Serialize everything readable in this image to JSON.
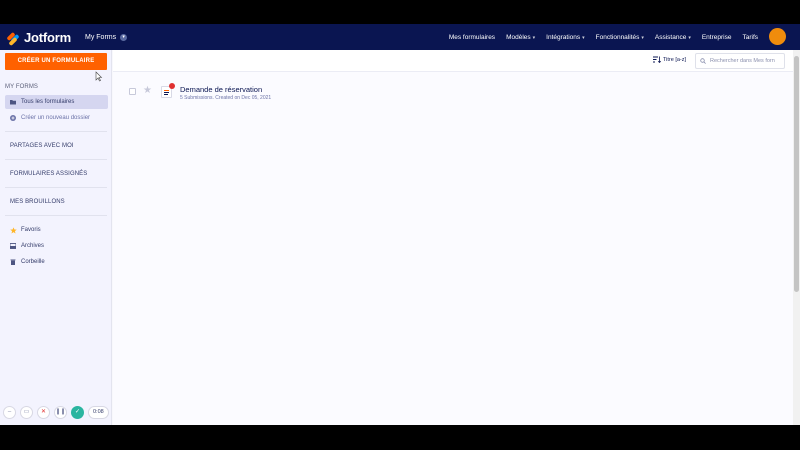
{
  "brand": {
    "name": "Jotform"
  },
  "header": {
    "context_label": "My Forms",
    "nav": [
      {
        "label": "Mes formulaires",
        "has_caret": false
      },
      {
        "label": "Modèles",
        "has_caret": true
      },
      {
        "label": "Intégrations",
        "has_caret": true
      },
      {
        "label": "Fonctionnalités",
        "has_caret": true
      },
      {
        "label": "Assistance",
        "has_caret": true
      },
      {
        "label": "Entreprise",
        "has_caret": false
      },
      {
        "label": "Tarifs",
        "has_caret": false
      }
    ]
  },
  "sidebar": {
    "create_label": "CRÉER UN FORMULAIRE",
    "my_forms_title": "MY FORMS",
    "all_forms_label": "Tous les formulaires",
    "new_folder_label": "Créer un nouveau dossier",
    "shared_label": "PARTAGES AVEC MOI",
    "assigned_label": "FORMULAIRES ASSIGNÉS",
    "drafts_label": "MES BROUILLONS",
    "favorites_label": "Favoris",
    "archives_label": "Archives",
    "trash_label": "Corbeille"
  },
  "toolbar": {
    "sort_label": "Titre [a-z]",
    "search_placeholder": "Rechercher dans Mes forn"
  },
  "forms": [
    {
      "title": "Demande de réservation",
      "meta": "5 Submissions. Created on Dec 05, 2021"
    }
  ],
  "recorder": {
    "time": "0:08"
  },
  "colors": {
    "nav_bg": "#0a1551",
    "create_button": "#ff6100",
    "avatar": "#f08c0c",
    "sidebar_bg": "#f3f3fe",
    "active_item": "#d5d6f0"
  }
}
